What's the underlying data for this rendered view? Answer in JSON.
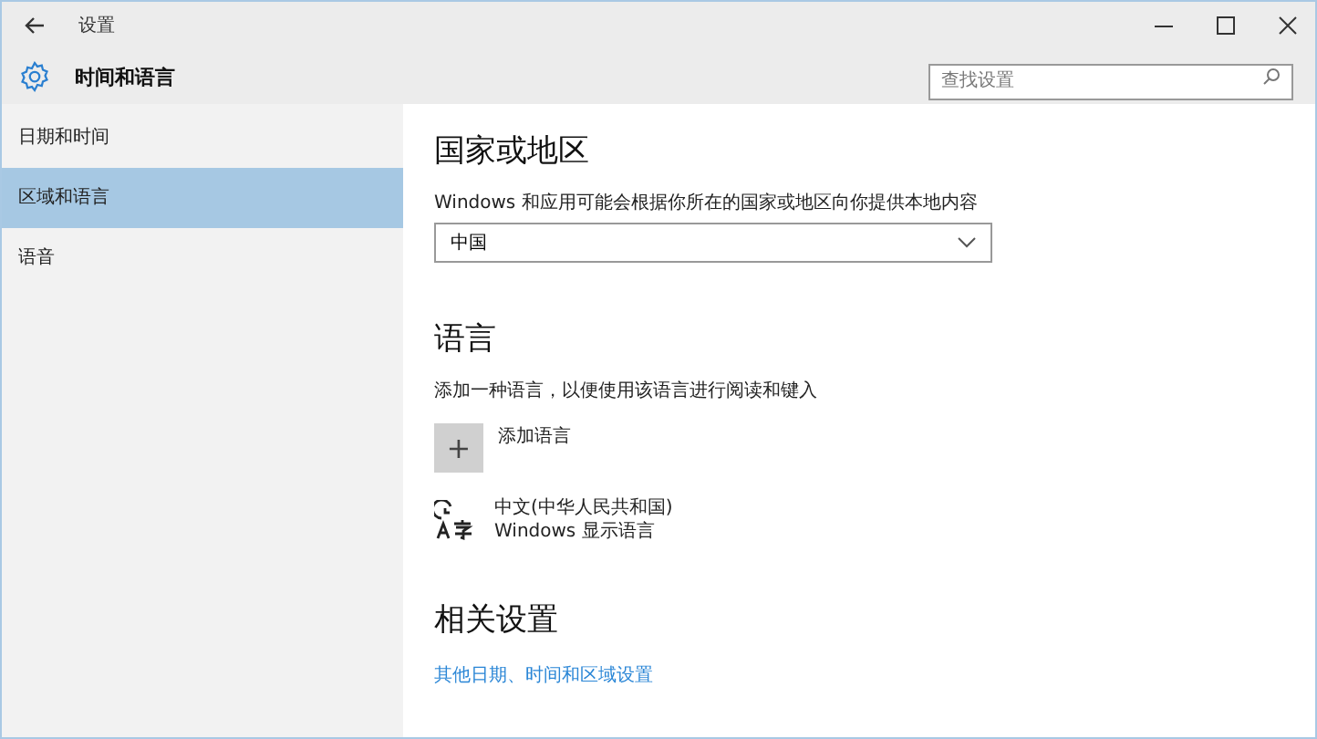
{
  "window": {
    "title": "设置"
  },
  "header": {
    "title": "时间和语言",
    "search": {
      "placeholder": "查找设置"
    }
  },
  "sidebar": {
    "items": [
      {
        "label": "日期和时间",
        "selected": false
      },
      {
        "label": "区域和语言",
        "selected": true
      },
      {
        "label": "语音",
        "selected": false
      }
    ]
  },
  "region": {
    "heading": "国家或地区",
    "description": "Windows 和应用可能会根据你所在的国家或地区向你提供本地内容",
    "dropdown": {
      "value": "中国"
    }
  },
  "language": {
    "heading": "语言",
    "description": "添加一种语言，以便使用该语言进行阅读和键入",
    "add_button": {
      "icon": "+",
      "label": "添加语言"
    },
    "languages": [
      {
        "name": "中文(中华人民共和国)",
        "detail": "Windows 显示语言"
      }
    ]
  },
  "related": {
    "heading": "相关设置",
    "links": [
      "其他日期、时间和区域设置"
    ]
  }
}
